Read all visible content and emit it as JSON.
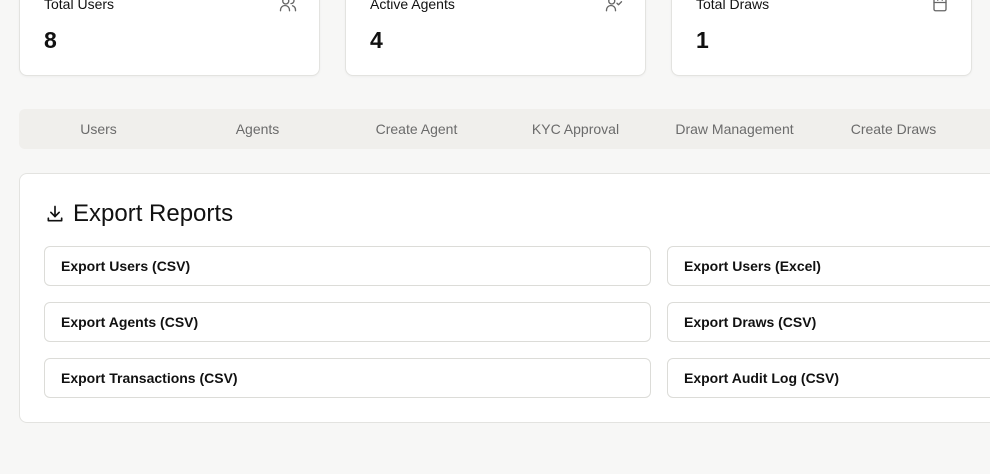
{
  "stats": [
    {
      "label": "Total Users",
      "value": "8",
      "icon": "users-icon"
    },
    {
      "label": "Active Agents",
      "value": "4",
      "icon": "user-check-icon"
    },
    {
      "label": "Total Draws",
      "value": "1",
      "icon": "calendar-icon"
    }
  ],
  "tabs": [
    "Users",
    "Agents",
    "Create Agent",
    "KYC Approval",
    "Draw Management",
    "Create Draws"
  ],
  "export": {
    "title": "Export Reports",
    "icon": "download-icon",
    "buttons": [
      "Export Users (CSV)",
      "Export Users (Excel)",
      "Export Agents (CSV)",
      "Export Draws (CSV)",
      "Export Transactions (CSV)",
      "Export Audit Log (CSV)"
    ]
  }
}
